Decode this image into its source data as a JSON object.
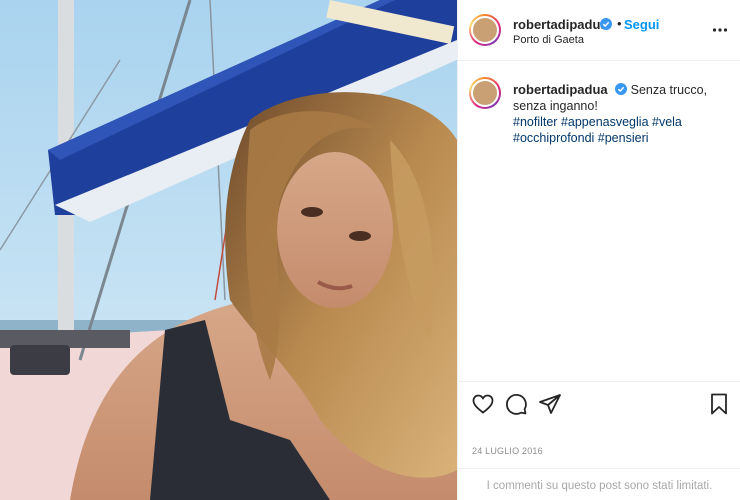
{
  "post": {
    "username": "robertadipadua",
    "verified": true,
    "follow_label": "Segui",
    "separator": "•",
    "location": "Porto di Gaeta",
    "caption": "Senza trucco, senza inganno!",
    "hashtags": "#nofilter #appenasveglia #vela #occhiprofondi #pensieri",
    "date": "24 LUGLIO 2016",
    "comments_notice": "I commenti su questo post sono stati limitati."
  },
  "icons": {
    "more": "more-options-icon",
    "verified": "verified-badge-icon",
    "like": "heart-icon",
    "comment": "comment-bubble-icon",
    "share": "paper-plane-icon",
    "save": "bookmark-icon"
  },
  "colors": {
    "accent": "#0095f6",
    "verified": "#3897f0",
    "hashtag": "#00376b",
    "muted": "#8e8e8e"
  }
}
